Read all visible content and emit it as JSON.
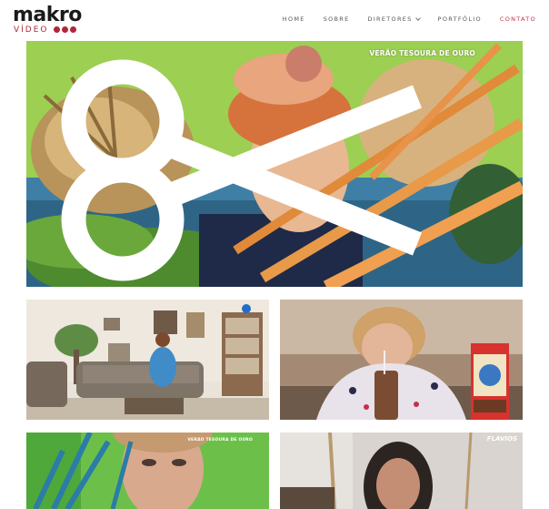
{
  "brand": {
    "name": "makro",
    "sub": "VÍDEO",
    "accent": "#b0273a"
  },
  "nav": {
    "items": [
      {
        "label": "HOME"
      },
      {
        "label": "SOBRE"
      },
      {
        "label": "DIRETORES"
      },
      {
        "label": "PORTFÓLIO"
      },
      {
        "label": "CONTATO"
      }
    ],
    "active_color": "#c2314a"
  },
  "portfolio": {
    "hero": {
      "overlay": "VERÃO TESOURA DE OURO"
    },
    "tile_4": {
      "overlay": "VERÃO TESOURA DE OURO"
    },
    "tile_5": {
      "overlay": "FLAVIOS"
    }
  }
}
